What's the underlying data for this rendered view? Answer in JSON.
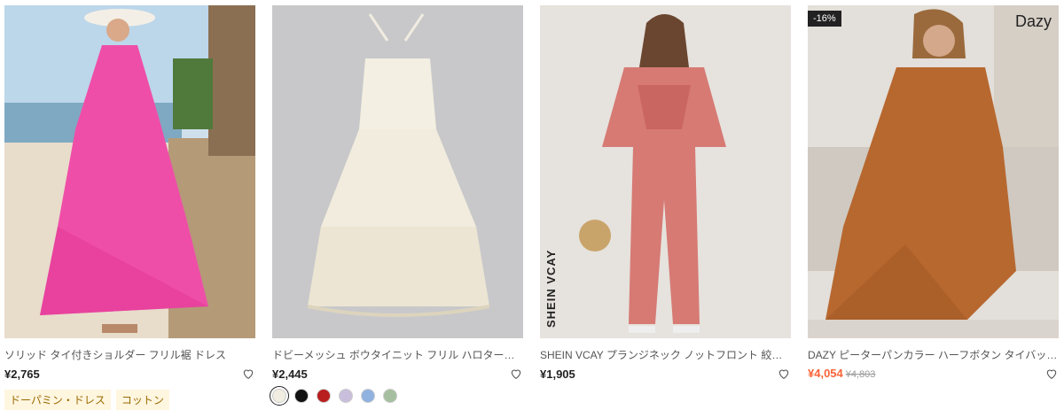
{
  "products": [
    {
      "title": "ソリッド タイ付きショルダー フリル裾 ドレス",
      "price": "¥2,765",
      "tags": [
        "ドーパミン・ドレス",
        "コットン"
      ]
    },
    {
      "title": "ドビーメッシュ ボウタイニット フリル ハロタードレス",
      "price": "¥2,445",
      "swatches": [
        "#f1ede0",
        "#111111",
        "#b81e1e",
        "#c9bfdc",
        "#8fb2e0",
        "#a6bfa0"
      ]
    },
    {
      "title": "SHEIN VCAY プランジネック ノットフロント 絞り染め ジャンプスーツ",
      "price": "¥1,905",
      "image_logo": "SHEIN VCAY"
    },
    {
      "title": "DAZY ピーターパンカラー ハーフボタン タイバック ドレス",
      "price": "¥4,054",
      "original_price": "¥4,803",
      "discount": "-16%",
      "image_brand": "Dazy"
    }
  ],
  "colors": {
    "sale_price": "#fa6338",
    "tag_bg": "#fff6e0",
    "tag_text": "#9a6b00"
  },
  "icons": {
    "wishlist": "heart-outline-icon"
  }
}
